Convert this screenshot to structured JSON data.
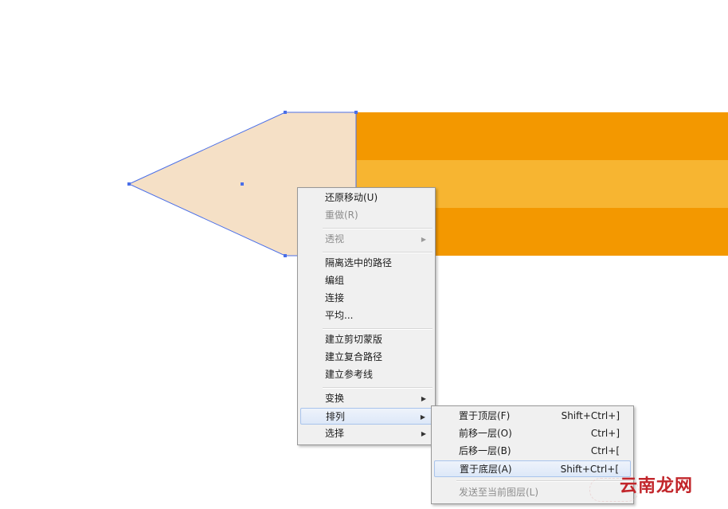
{
  "colors": {
    "bar_dark": "#f39800",
    "bar_light": "#f7b531",
    "tip_fill": "#f5e0c6",
    "selection": "#4a6fe8"
  },
  "context_menu": {
    "items": [
      {
        "label": "还原移动(U)",
        "enabled": true
      },
      {
        "label": "重做(R)",
        "enabled": false
      },
      {
        "label": "透视",
        "enabled": false,
        "submenu": true
      },
      {
        "label": "隔离选中的路径",
        "enabled": true
      },
      {
        "label": "编组",
        "enabled": true
      },
      {
        "label": "连接",
        "enabled": true
      },
      {
        "label": "平均...",
        "enabled": true
      },
      {
        "label": "建立剪切蒙版",
        "enabled": true
      },
      {
        "label": "建立复合路径",
        "enabled": true
      },
      {
        "label": "建立参考线",
        "enabled": true
      },
      {
        "label": "变换",
        "enabled": true,
        "submenu": true
      },
      {
        "label": "排列",
        "enabled": true,
        "submenu": true,
        "highlighted": true
      },
      {
        "label": "选择",
        "enabled": true,
        "submenu": true
      }
    ]
  },
  "arrange_submenu": {
    "items": [
      {
        "label": "置于顶层(F)",
        "shortcut": "Shift+Ctrl+]"
      },
      {
        "label": "前移一层(O)",
        "shortcut": "Ctrl+]"
      },
      {
        "label": "后移一层(B)",
        "shortcut": "Ctrl+["
      },
      {
        "label": "置于底层(A)",
        "shortcut": "Shift+Ctrl+[",
        "highlighted": true
      },
      {
        "label": "发送至当前图层(L)",
        "shortcut": "",
        "enabled": false
      }
    ]
  },
  "watermark": "云南龙网"
}
